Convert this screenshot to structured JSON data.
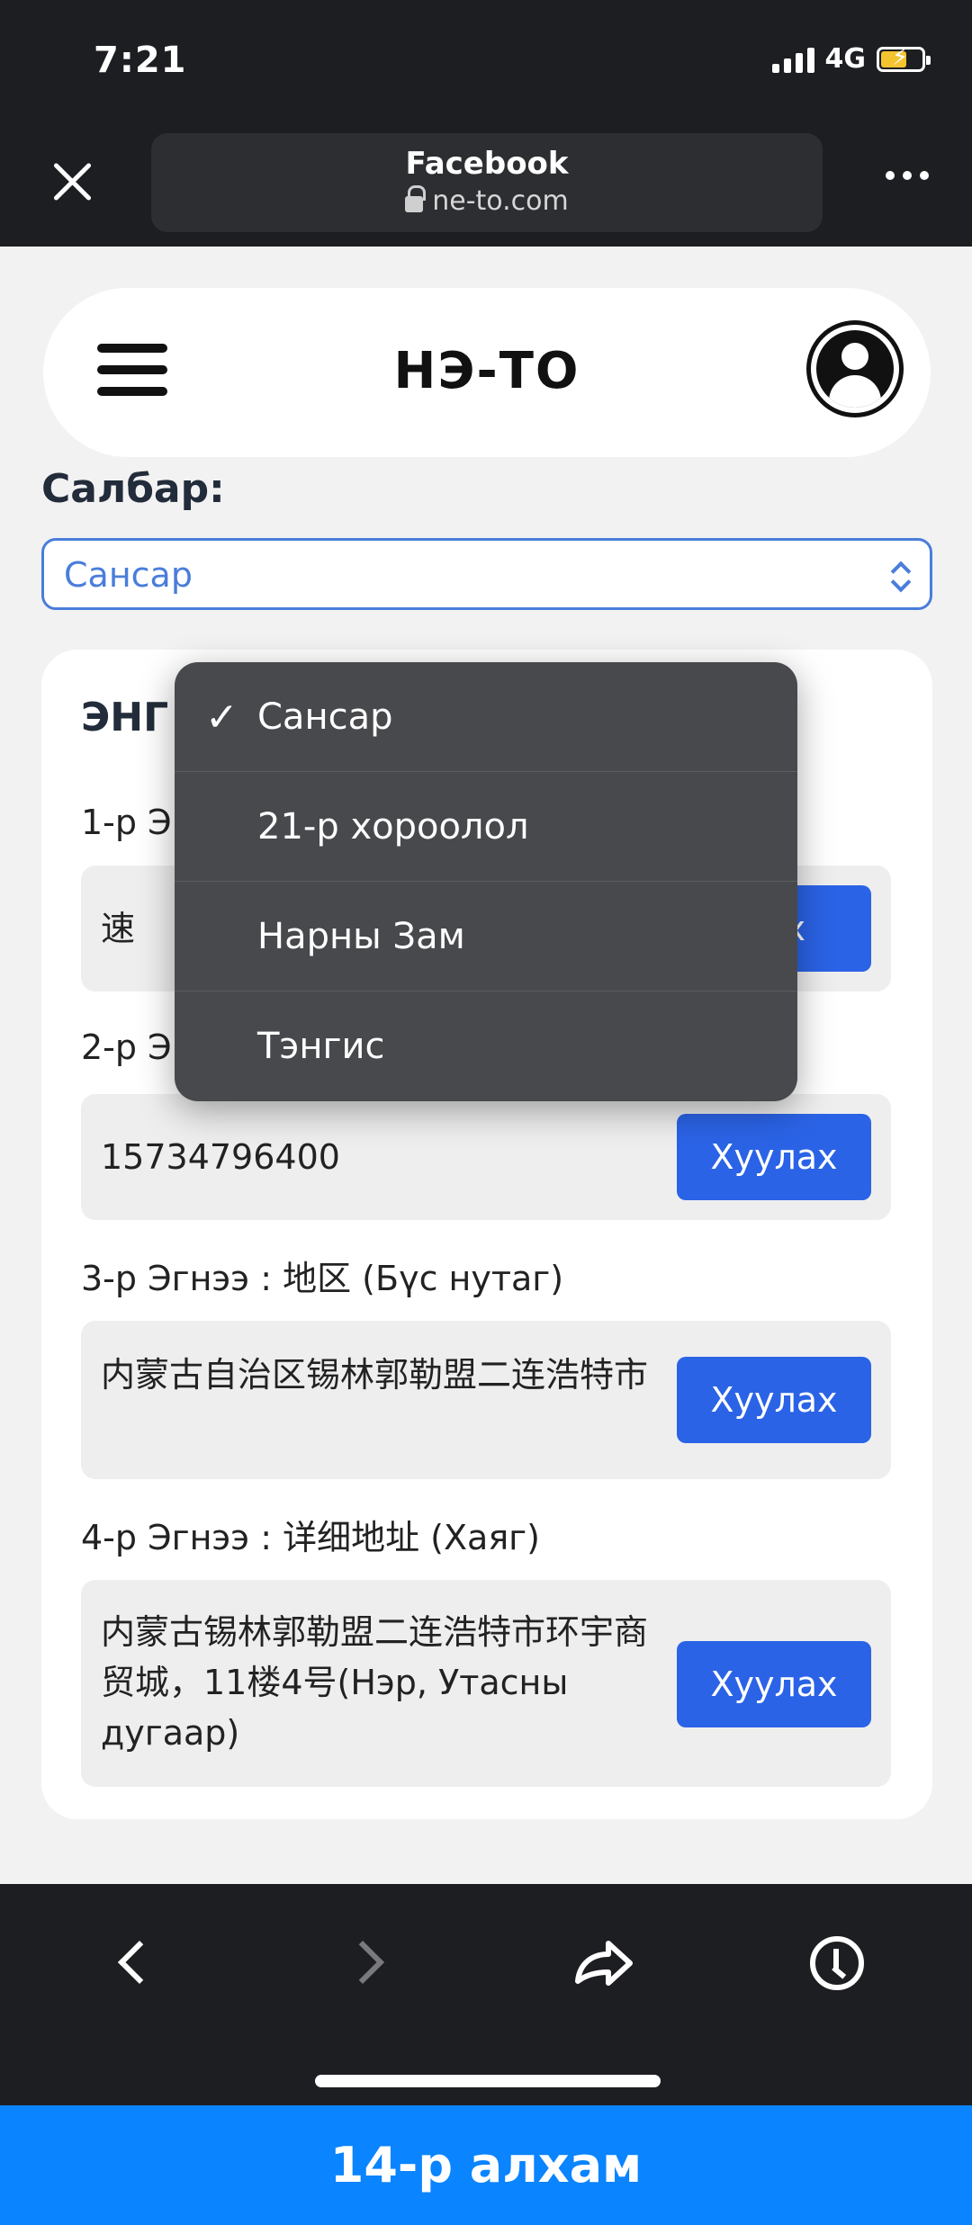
{
  "status": {
    "time": "7:21",
    "network": "4G"
  },
  "browser": {
    "title": "Facebook",
    "host": "ne-to.com"
  },
  "header": {
    "brand": "НЭ-ТО"
  },
  "branch": {
    "label": "Салбар:",
    "selected": "Сансар"
  },
  "card": {
    "title": "ЭНГ",
    "steps": [
      {
        "label": "1-р Э",
        "value": "速",
        "button": "лах"
      },
      {
        "label": "2-р Э",
        "value": "15734796400",
        "button": "Хуулах"
      },
      {
        "label": "3-р Эгнээ : 地区 (Бүс нутаг)",
        "value": "内蒙古自治区锡林郭勒盟二连浩特市",
        "button": "Хуулах"
      },
      {
        "label": "4-р Эгнээ : 详细地址 (Хаяг)",
        "value": "内蒙古锡林郭勒盟二连浩特市环宇商贸城，11楼4号(Нэр, Утасны дугаар)",
        "button": "Хуулах"
      }
    ]
  },
  "dropdown": {
    "options": [
      {
        "label": "Сансар",
        "check": "✓"
      },
      {
        "label": "21-р хороолол"
      },
      {
        "label": "Нарны Зам"
      },
      {
        "label": "Тэнгис"
      }
    ]
  },
  "banner": {
    "text": "14-р алхам"
  },
  "colors": {
    "accent": "#2b63e6",
    "banner": "#0a84ff",
    "select_border": "#4a7ddb"
  }
}
